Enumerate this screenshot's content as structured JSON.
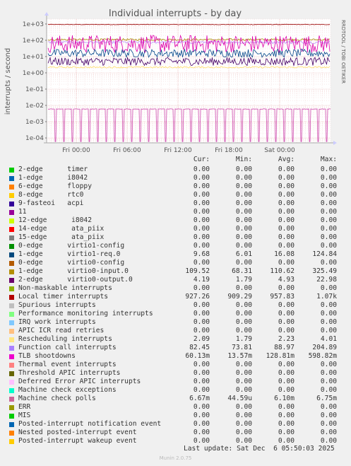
{
  "title": "Individual interrupts - by day",
  "side_label": "RRDTOOL / TOBI OETIKER",
  "chart_data": {
    "type": "line",
    "title": "Individual interrupts - by day",
    "ylabel": "interrupts / second",
    "y_scale": "log",
    "ylim": [
      5e-05,
      2000
    ],
    "y_ticks": [
      {
        "value": 1000,
        "label": "1e+03"
      },
      {
        "value": 100,
        "label": "1e+02"
      },
      {
        "value": 10,
        "label": "1e+01"
      },
      {
        "value": 1,
        "label": "1e+00"
      },
      {
        "value": 0.1,
        "label": "1e-01"
      },
      {
        "value": 0.01,
        "label": "1e-02"
      },
      {
        "value": 0.001,
        "label": "1e-03"
      },
      {
        "value": 0.0001,
        "label": "1e-04"
      }
    ],
    "x_ticks": [
      "Fri 00:00",
      "Fri 06:00",
      "Fri 12:00",
      "Fri 18:00",
      "Sat 00:00"
    ],
    "series": [
      {
        "name": "Local timer interrupts",
        "color": "#990000",
        "level": 930
      },
      {
        "name": "1-edge virtio0-input.0",
        "color": "#aa8800",
        "level": 110
      },
      {
        "name": "Function call interrupts",
        "color": "#bb99ff",
        "level": 75
      },
      {
        "name": "TLB shootdowns",
        "color": "#dd00aa",
        "level": 60
      },
      {
        "name": "1-edge virtio1-req.0",
        "color": "#004488",
        "level": 16
      },
      {
        "name": "2-edge virtio0-output.0",
        "color": "#440066",
        "level": 5
      },
      {
        "name": "Rescheduling interrupts",
        "color": "#ffdd66",
        "level": 2.2
      },
      {
        "name": "Machine check polls",
        "color": "#cc44aa",
        "level": 0.006
      }
    ]
  },
  "legend": {
    "headers": {
      "cur": "Cur:",
      "min": "Min:",
      "avg": "Avg:",
      "max": "Max:"
    },
    "rows": [
      {
        "name": "2-edge      timer",
        "color": "#00cc00",
        "cur": "0.00",
        "min": "0.00",
        "avg": "0.00",
        "max": "0.00"
      },
      {
        "name": "1-edge      i8042",
        "color": "#0066b3",
        "cur": "0.00",
        "min": "0.00",
        "avg": "0.00",
        "max": "0.00"
      },
      {
        "name": "6-edge      floppy",
        "color": "#ff8000",
        "cur": "0.00",
        "min": "0.00",
        "avg": "0.00",
        "max": "0.00"
      },
      {
        "name": "8-edge      rtc0",
        "color": "#ffcc00",
        "cur": "0.00",
        "min": "0.00",
        "avg": "0.00",
        "max": "0.00"
      },
      {
        "name": "9-fasteoi   acpi",
        "color": "#330099",
        "cur": "0.00",
        "min": "0.00",
        "avg": "0.00",
        "max": "0.00"
      },
      {
        "name": "11",
        "color": "#990099",
        "cur": "0.00",
        "min": "0.00",
        "avg": "0.00",
        "max": "0.00"
      },
      {
        "name": "12-edge      i8042",
        "color": "#ccff00",
        "cur": "0.00",
        "min": "0.00",
        "avg": "0.00",
        "max": "0.00"
      },
      {
        "name": "14-edge      ata_piix",
        "color": "#ff0000",
        "cur": "0.00",
        "min": "0.00",
        "avg": "0.00",
        "max": "0.00"
      },
      {
        "name": "15-edge      ata_piix",
        "color": "#808080",
        "cur": "0.00",
        "min": "0.00",
        "avg": "0.00",
        "max": "0.00"
      },
      {
        "name": "0-edge      virtio1-config",
        "color": "#008f00",
        "cur": "0.00",
        "min": "0.00",
        "avg": "0.00",
        "max": "0.00"
      },
      {
        "name": "1-edge      virtio1-req.0",
        "color": "#00487d",
        "cur": "9.68",
        "min": "6.01",
        "avg": "16.08",
        "max": "124.84"
      },
      {
        "name": "0-edge      virtio0-config",
        "color": "#b35a00",
        "cur": "0.00",
        "min": "0.00",
        "avg": "0.00",
        "max": "0.00"
      },
      {
        "name": "1-edge      virtio0-input.0",
        "color": "#b38f00",
        "cur": "109.52",
        "min": "68.31",
        "avg": "110.62",
        "max": "325.49"
      },
      {
        "name": "2-edge      virtio0-output.0",
        "color": "#6b006b",
        "cur": "4.19",
        "min": "1.79",
        "avg": "4.93",
        "max": "22.98"
      },
      {
        "name": "Non-maskable interrupts",
        "color": "#8fb300",
        "cur": "0.00",
        "min": "0.00",
        "avg": "0.00",
        "max": "0.00"
      },
      {
        "name": "Local timer interrupts",
        "color": "#b30000",
        "cur": "927.26",
        "min": "909.29",
        "avg": "957.83",
        "max": "1.07k"
      },
      {
        "name": "Spurious interrupts",
        "color": "#bebebe",
        "cur": "0.00",
        "min": "0.00",
        "avg": "0.00",
        "max": "0.00"
      },
      {
        "name": "Performance monitoring interrupts",
        "color": "#80ff80",
        "cur": "0.00",
        "min": "0.00",
        "avg": "0.00",
        "max": "0.00"
      },
      {
        "name": "IRQ work interrupts",
        "color": "#80c9ff",
        "cur": "0.00",
        "min": "0.00",
        "avg": "0.00",
        "max": "0.00"
      },
      {
        "name": "APIC ICR read retries",
        "color": "#ffc080",
        "cur": "0.00",
        "min": "0.00",
        "avg": "0.00",
        "max": "0.00"
      },
      {
        "name": "Rescheduling interrupts",
        "color": "#ffe680",
        "cur": "2.09",
        "min": "1.79",
        "avg": "2.23",
        "max": "4.01"
      },
      {
        "name": "Function call interrupts",
        "color": "#aa80ff",
        "cur": "82.45",
        "min": "73.81",
        "avg": "88.97",
        "max": "204.89"
      },
      {
        "name": "TLB shootdowns",
        "color": "#ee00cc",
        "cur": "60.13m",
        "min": "13.57m",
        "avg": "128.81m",
        "max": "598.82m"
      },
      {
        "name": "Thermal event interrupts",
        "color": "#ff8080",
        "cur": "0.00",
        "min": "0.00",
        "avg": "0.00",
        "max": "0.00"
      },
      {
        "name": "Threshold APIC interrupts",
        "color": "#666600",
        "cur": "0.00",
        "min": "0.00",
        "avg": "0.00",
        "max": "0.00"
      },
      {
        "name": "Deferred Error APIC interrupts",
        "color": "#ffbfff",
        "cur": "0.00",
        "min": "0.00",
        "avg": "0.00",
        "max": "0.00"
      },
      {
        "name": "Machine check exceptions",
        "color": "#00ffcc",
        "cur": "0.00",
        "min": "0.00",
        "avg": "0.00",
        "max": "0.00"
      },
      {
        "name": "Machine check polls",
        "color": "#cc6699",
        "cur": "6.67m",
        "min": "44.59u",
        "avg": "6.10m",
        "max": "6.75m"
      },
      {
        "name": "ERR",
        "color": "#999900",
        "cur": "0.00",
        "min": "0.00",
        "avg": "0.00",
        "max": "0.00"
      },
      {
        "name": "MIS",
        "color": "#00cc00",
        "cur": "0.00",
        "min": "0.00",
        "avg": "0.00",
        "max": "0.00"
      },
      {
        "name": "Posted-interrupt notification event",
        "color": "#0066b3",
        "cur": "0.00",
        "min": "0.00",
        "avg": "0.00",
        "max": "0.00"
      },
      {
        "name": "Nested posted-interrupt event",
        "color": "#ff8000",
        "cur": "0.00",
        "min": "0.00",
        "avg": "0.00",
        "max": "0.00"
      },
      {
        "name": "Posted-interrupt wakeup event",
        "color": "#ffcc00",
        "cur": "0.00",
        "min": "0.00",
        "avg": "0.00",
        "max": "0.00"
      }
    ]
  },
  "last_update": "Last update: Sat Dec  6 05:50:03 2025",
  "footer": "Munin 2.0.75"
}
